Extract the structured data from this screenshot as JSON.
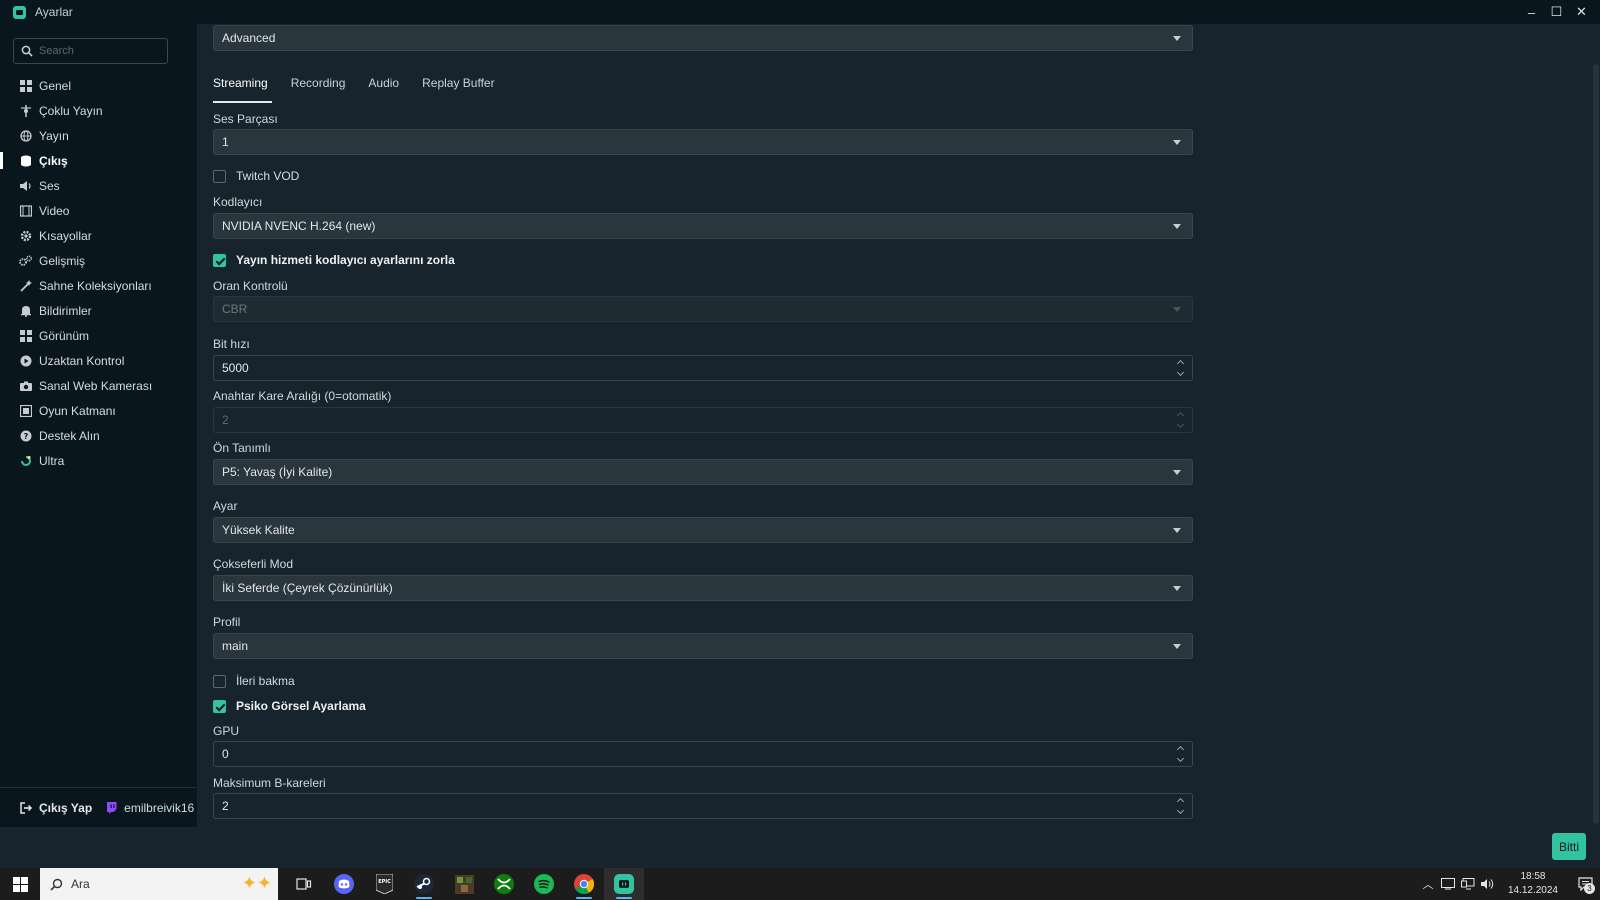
{
  "window": {
    "title": "Ayarlar",
    "minimize_icon": "–",
    "maximize_icon": "☐",
    "close_icon": "✕"
  },
  "sidebar": {
    "search_placeholder": "Search",
    "items": [
      {
        "label": "Genel",
        "icon": "grid-icon"
      },
      {
        "label": "Çoklu Yayın",
        "icon": "multistream-icon"
      },
      {
        "label": "Yayın",
        "icon": "globe-icon"
      },
      {
        "label": "Çıkış",
        "icon": "output-icon",
        "active": true
      },
      {
        "label": "Ses",
        "icon": "speaker-icon"
      },
      {
        "label": "Video",
        "icon": "film-icon"
      },
      {
        "label": "Kısayollar",
        "icon": "gear-icon"
      },
      {
        "label": "Gelişmiş",
        "icon": "gears-icon"
      },
      {
        "label": "Sahne Koleksiyonları",
        "icon": "magic-wand-icon"
      },
      {
        "label": "Bildirimler",
        "icon": "bell-icon"
      },
      {
        "label": "Görünüm",
        "icon": "layout-icon"
      },
      {
        "label": "Uzaktan Kontrol",
        "icon": "play-circle-icon"
      },
      {
        "label": "Sanal Web Kamerası",
        "icon": "camera-icon"
      },
      {
        "label": "Oyun Katmanı",
        "icon": "overlay-icon"
      },
      {
        "label": "Destek Alın",
        "icon": "help-icon"
      },
      {
        "label": "Ultra",
        "icon": "ultra-icon"
      }
    ],
    "footer": {
      "logout_label": "Çıkış Yap",
      "username": "emilbreivik16"
    }
  },
  "main": {
    "mode_select": "Advanced",
    "tabs": [
      {
        "label": "Streaming",
        "active": true
      },
      {
        "label": "Recording"
      },
      {
        "label": "Audio"
      },
      {
        "label": "Replay Buffer"
      }
    ],
    "audio_track": {
      "label": "Ses Parçası",
      "value": "1"
    },
    "twitch_vod": {
      "label": "Twitch VOD",
      "checked": false
    },
    "encoder": {
      "label": "Kodlayıcı",
      "value": "NVIDIA NVENC H.264 (new)"
    },
    "enforce": {
      "label": "Yayın hizmeti kodlayıcı ayarlarını zorla",
      "checked": true
    },
    "rate_control": {
      "label": "Oran Kontrolü",
      "value": "CBR"
    },
    "bitrate": {
      "label": "Bit hızı",
      "value": "5000"
    },
    "keyframe": {
      "label": "Anahtar Kare Aralığı (0=otomatik)",
      "value": "2"
    },
    "preset": {
      "label": "Ön Tanımlı",
      "value": "P5: Yavaş (İyi Kalite)"
    },
    "tuning": {
      "label": "Ayar",
      "value": "Yüksek Kalite"
    },
    "multipass": {
      "label": "Çokseferli Mod",
      "value": "İki Seferde (Çeyrek Çözünürlük)"
    },
    "profile": {
      "label": "Profil",
      "value": "main"
    },
    "lookahead": {
      "label": "İleri bakma",
      "checked": false
    },
    "psycho": {
      "label": "Psiko Görsel Ayarlama",
      "checked": true
    },
    "gpu": {
      "label": "GPU",
      "value": "0"
    },
    "bframes": {
      "label": "Maksimum B-kareleri",
      "value": "2"
    },
    "done_label": "Bitti"
  },
  "taskbar": {
    "search_label": "Ara",
    "apps": [
      "task-view-icon",
      "discord-icon",
      "epic-games-icon",
      "steam-icon",
      "minecraft-icon",
      "xbox-icon",
      "spotify-icon",
      "chrome-icon",
      "streamlabs-icon"
    ],
    "time": "18:58",
    "date": "14.12.2024",
    "notification_count": "3"
  },
  "colors": {
    "accent": "#31c3a2",
    "background": "#17242d",
    "sidebar": "#09161d",
    "field": "#2a363d"
  }
}
